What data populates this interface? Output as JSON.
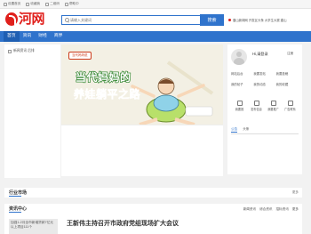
{
  "topbar": {
    "items": [
      "设置首页",
      "收藏我",
      "二维码",
      "帮助中"
    ]
  },
  "header": {
    "logo_text": "河网",
    "search_placeholder": "请输入关键词",
    "search_button": "搜索",
    "right_text": "唐山新闻网  开发区头条  大学生大赛  建山"
  },
  "nav": {
    "items": [
      "首页",
      "资讯",
      "财经",
      "商界"
    ]
  },
  "leftcol": {
    "item": "新闻资讯 后排"
  },
  "banner": {
    "tag": "当代妈妈说",
    "line1": "当代妈妈的",
    "line2": "养娃躺平之路"
  },
  "panel": {
    "greeting": "Hi,请登录",
    "register": "注册",
    "grid1": [
      "网站后台",
      "我要发帖",
      "我要投稿",
      "我的帖子",
      "我的动态",
      "我的收藏"
    ],
    "grid2": [
      "我要推",
      "发布信息",
      "我要推广",
      "广告联系"
    ],
    "tabs": [
      "公告",
      "头条"
    ]
  },
  "industry": {
    "title": "行业市场",
    "more": "更多"
  },
  "news": {
    "title": "资讯中心",
    "links": [
      "新闻资讯",
      "综合资讯",
      "招标资讯",
      "更多"
    ],
    "thumb_caption": "加强1-2月全市新增贷款7亿元 以上项目111个",
    "headline": "王新伟主持召开市政府党组现场扩大会议"
  },
  "colors": {
    "brand_red": "#e0201c",
    "nav_blue": "#2f73cc"
  }
}
